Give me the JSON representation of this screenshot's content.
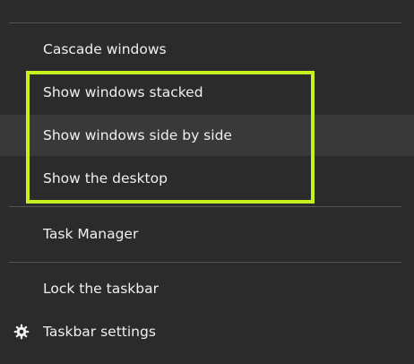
{
  "menu": {
    "items": [
      {
        "label": "Cascade windows"
      },
      {
        "label": "Show windows stacked"
      },
      {
        "label": "Show windows side by side"
      },
      {
        "label": "Show the desktop"
      },
      {
        "label": "Task Manager"
      },
      {
        "label": "Lock the taskbar"
      },
      {
        "label": "Taskbar settings",
        "icon": "gear-icon"
      }
    ]
  },
  "colors": {
    "background": "#2b2b2b",
    "hover_background": "#393939",
    "separator": "#555555",
    "text": "#f0f0f0",
    "annotation_box": "#c6f01e"
  }
}
